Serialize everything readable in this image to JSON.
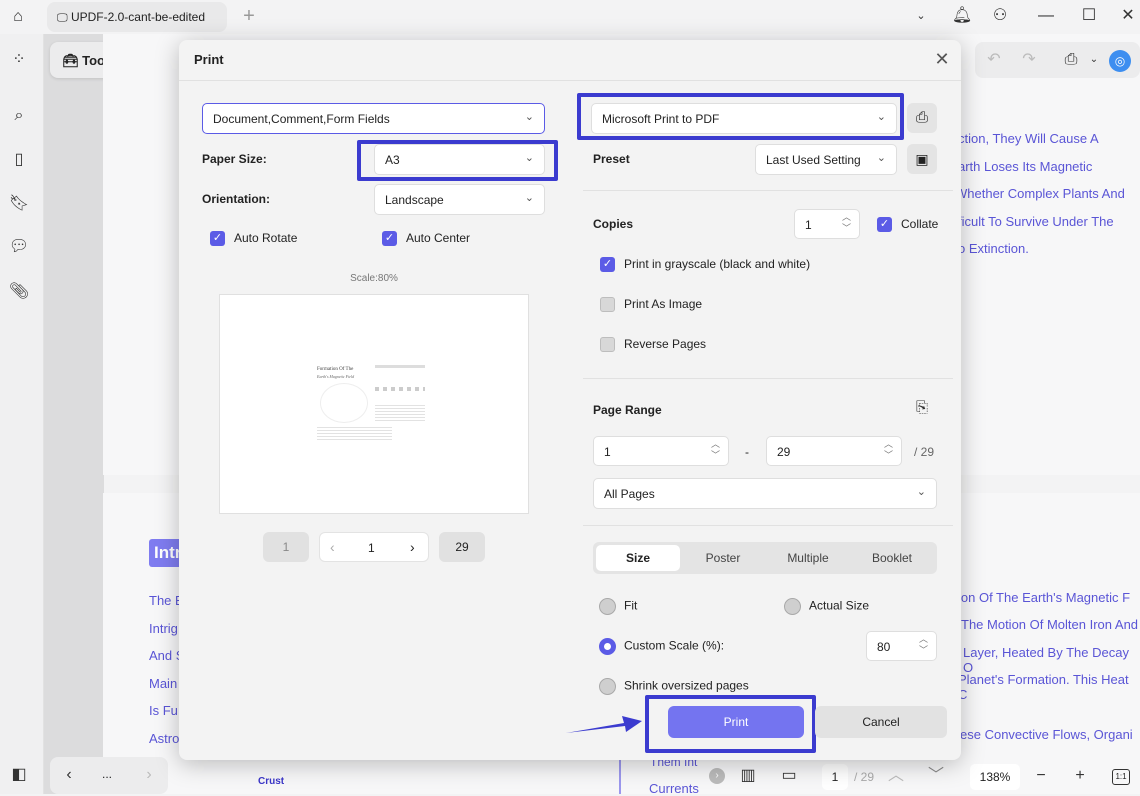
{
  "titlebar": {
    "tab_title": "UPDF-2.0-cant-be-edited",
    "tools_label": "Tools"
  },
  "document": {
    "right_lines_top": [
      "ction, They Will Cause A",
      "arth Loses Its Magnetic",
      "Whether Complex Plants And",
      "ficult To Survive Under The",
      "o Extinction."
    ],
    "heading_partial": "Intr",
    "left_lines": [
      "The E",
      "Intrig",
      "And S",
      "Main",
      "Is Fu",
      "Astro"
    ],
    "right_lines_bottom": [
      "ion Of The Earth's Magnetic F",
      "The Motion Of Molten Iron And",
      "Layer, Heated By The Decay O",
      "Planet's Formation. This Heat C",
      "ese Convective Flows, Organi"
    ],
    "bottom_fragments": {
      "crust": "Crust",
      "them": "Them Int",
      "currents": "Currents"
    }
  },
  "dialog": {
    "title": "Print",
    "content_select": "Document,Comment,Form Fields",
    "paper_size_label": "Paper Size:",
    "paper_size": "A3",
    "orientation_label": "Orientation:",
    "orientation": "Landscape",
    "auto_rotate": "Auto Rotate",
    "auto_center": "Auto Center",
    "scale_label": "Scale:80%",
    "preview": {
      "title": "Formation Of The",
      "subtitle": "Earth's Magnetic Field"
    },
    "pager": {
      "first": "1",
      "current": "1",
      "last": "29"
    },
    "printer": "Microsoft Print to PDF",
    "preset_label": "Preset",
    "preset": "Last Used Setting",
    "copies_label": "Copies",
    "copies": "1",
    "collate": "Collate",
    "grayscale": "Print in grayscale (black and white)",
    "print_as_image": "Print As Image",
    "reverse_pages": "Reverse Pages",
    "page_range_label": "Page Range",
    "range_from": "1",
    "range_dash": "-",
    "range_to": "29",
    "range_total": "/ 29",
    "pages_select": "All Pages",
    "tabs": [
      "Size",
      "Poster",
      "Multiple",
      "Booklet"
    ],
    "fit": "Fit",
    "actual_size": "Actual Size",
    "custom_scale": "Custom Scale (%):",
    "custom_scale_value": "80",
    "shrink": "Shrink oversized pages",
    "print_button": "Print",
    "cancel_button": "Cancel"
  },
  "statusbar": {
    "page": "1",
    "total": "/ 29",
    "zoom": "138%",
    "actual": "1:1",
    "more": "..."
  },
  "colors": {
    "accent": "#5b5be6",
    "highlight": "#3b3bcf",
    "print_button": "#7474f0",
    "doc_text": "#5a55d6"
  }
}
